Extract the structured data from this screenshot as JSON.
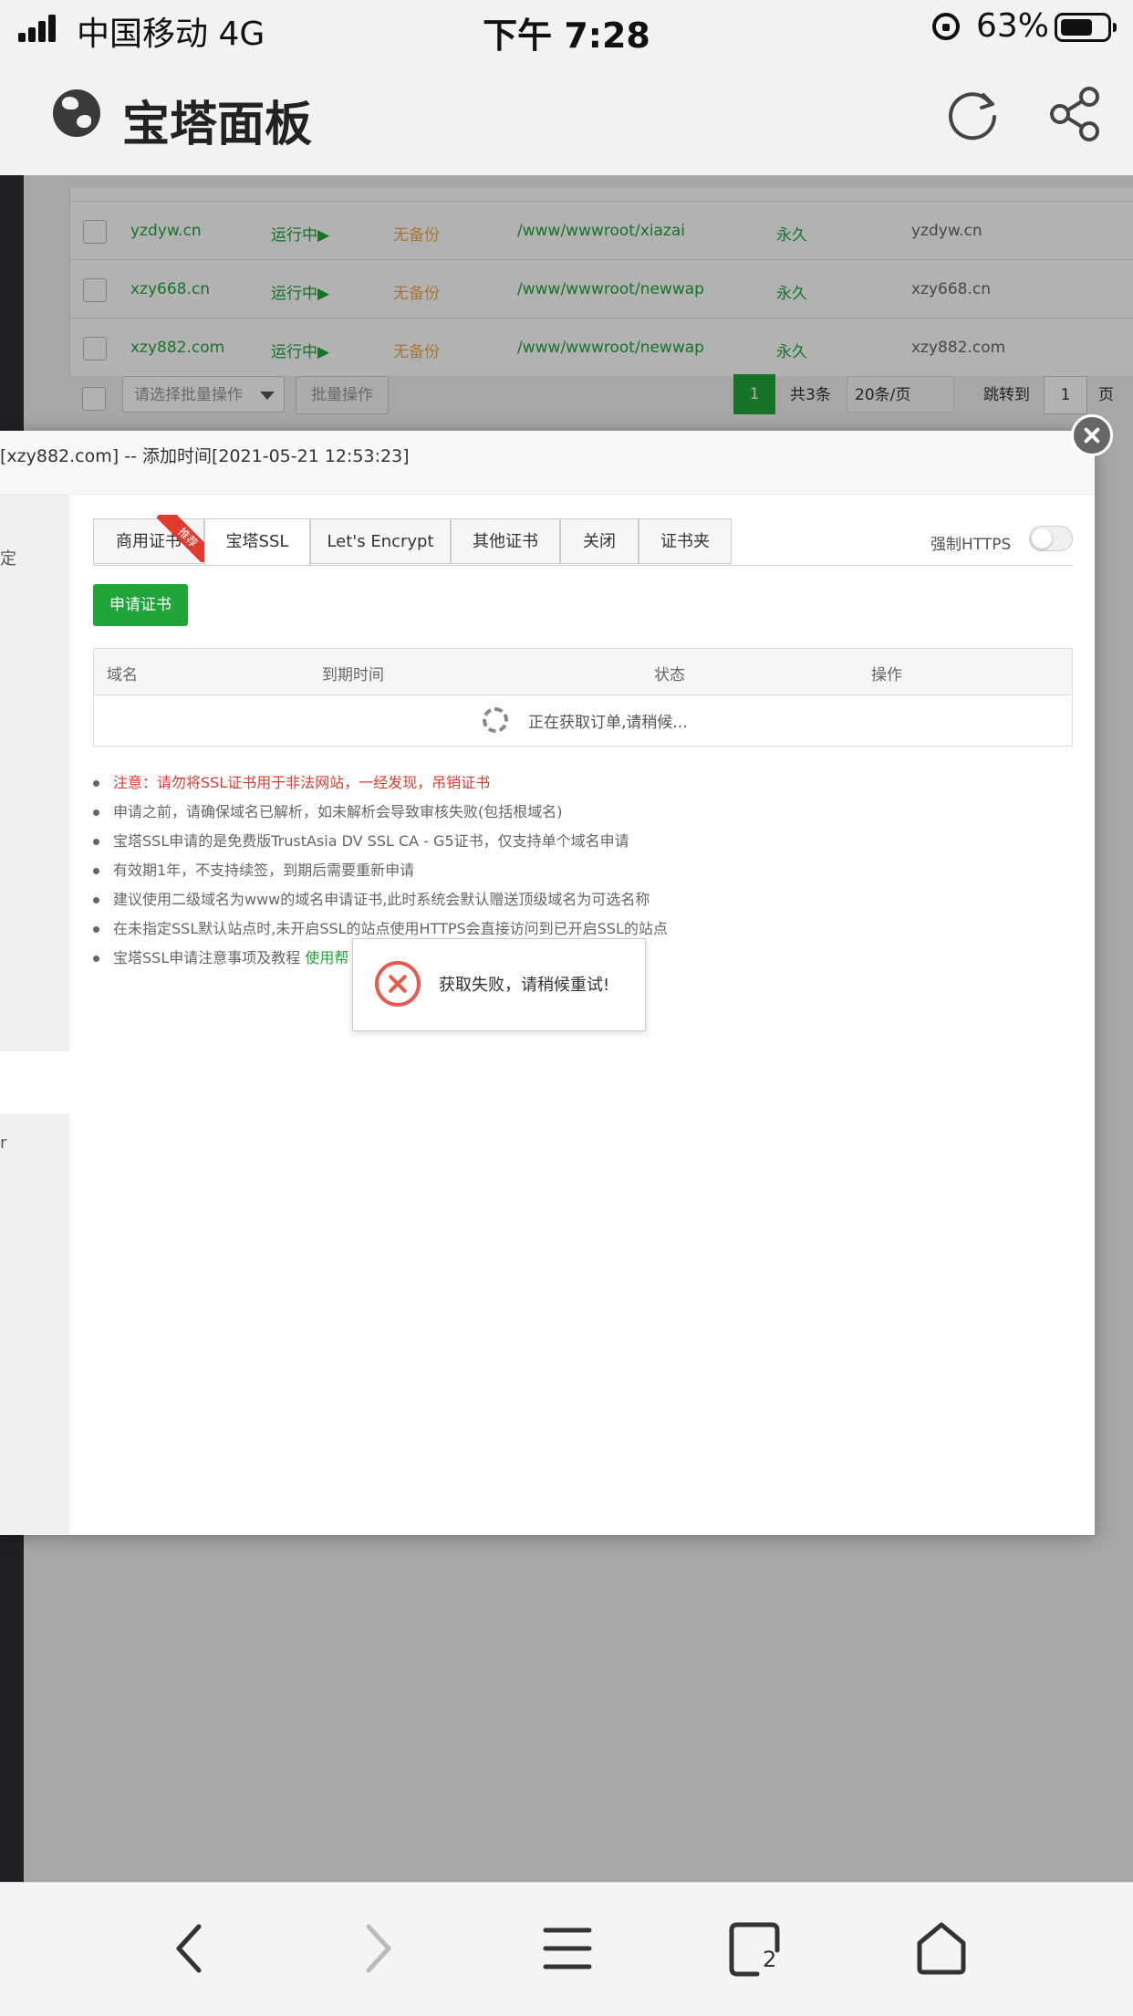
{
  "status_bar": {
    "carrier": "中国移动   4G",
    "time": "下午 7:28",
    "battery": "63%"
  },
  "app_header": {
    "title": "宝塔面板"
  },
  "site_table": {
    "rows": [
      {
        "domain": "yzdyw.cn",
        "status": "运行中▶",
        "backup": "无备份",
        "path": "/www/wwwroot/xiazai",
        "expire": "永久",
        "remark": "yzdyw.cn"
      },
      {
        "domain": "xzy668.cn",
        "status": "运行中▶",
        "backup": "无备份",
        "path": "/www/wwwroot/newwap",
        "expire": "永久",
        "remark": "xzy668.cn"
      },
      {
        "domain": "xzy882.com",
        "status": "运行中▶",
        "backup": "无备份",
        "path": "/www/wwwroot/newwap",
        "expire": "永久",
        "remark": "xzy882.com"
      }
    ],
    "bulk_placeholder": "请选择批量操作",
    "bulk_button": "批量操作",
    "pagination": {
      "current": "1",
      "total": "共3条",
      "page_size": "20条/页",
      "jump_label": "跳转到",
      "jump_value": "1",
      "unit": "页"
    }
  },
  "dialog": {
    "title": "[xzy882.com] -- 添加时间[2021-05-21 12:53:23]",
    "nav_fragments": [
      "定",
      "r"
    ],
    "tabs": [
      "商用证书",
      "宝塔SSL",
      "Let's Encrypt",
      "其他证书",
      "关闭",
      "证书夹"
    ],
    "ribbon": "推荐",
    "force_https_label": "强制HTTPS",
    "apply_button": "申请证书",
    "cert_table": {
      "columns": [
        "域名",
        "到期时间",
        "状态",
        "操作"
      ],
      "loading_text": "正在获取订单,请稍候..."
    },
    "notes": [
      "注意：请勿将SSL证书用于非法网站，一经发现，吊销证书",
      "申请之前，请确保域名已解析，如未解析会导致审核失败(包括根域名)",
      "宝塔SSL申请的是免费版TrustAsia DV SSL CA - G5证书，仅支持单个域名申请",
      "有效期1年，不支持续签，到期后需要重新申请",
      "建议使用二级域名为www的域名申请证书,此时系统会默认赠送顶级域名为可选名称",
      "在未指定SSL默认站点时,未开启SSL的站点使用HTTPS会直接访问到已开启SSL的站点"
    ],
    "last_note": "宝塔SSL申请注意事项及教程",
    "help_link": "使用帮"
  },
  "toast": {
    "message": "获取失败，请稍候重试!"
  },
  "bottom_bar": {
    "tabs_count": "2"
  },
  "colors": {
    "brand_green": "#20a53a",
    "warning_red": "#e03a2f",
    "backup_orange": "#f0ad4e"
  }
}
